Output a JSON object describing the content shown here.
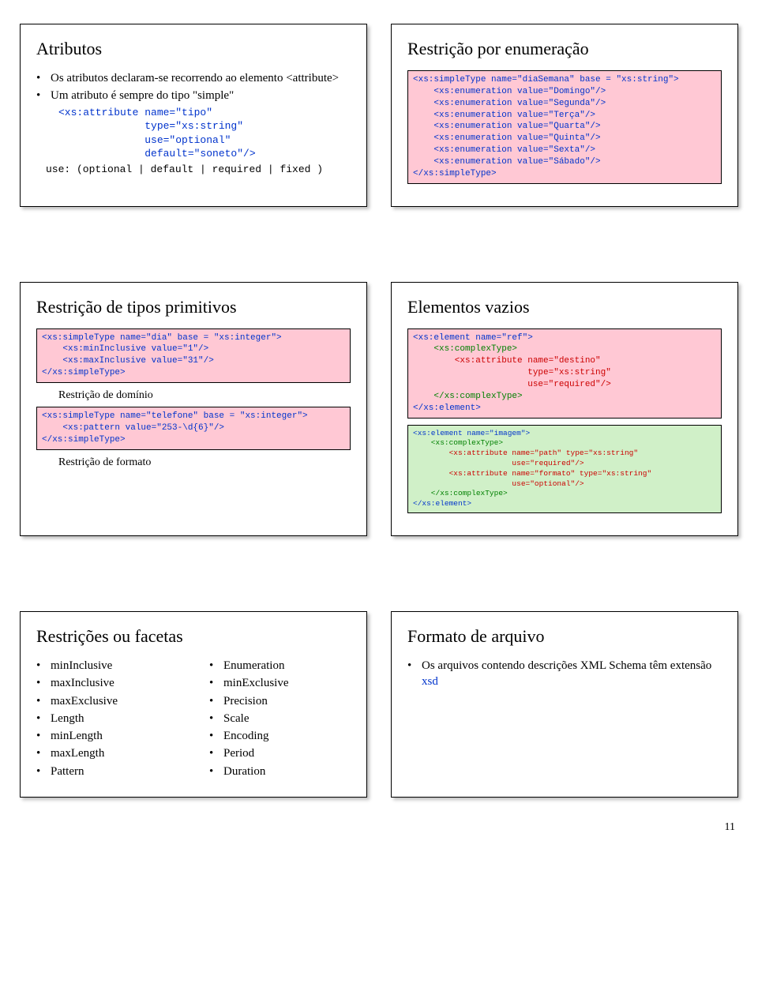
{
  "slide1": {
    "title": "Atributos",
    "b1": "Os atributos declaram-se recorrendo ao elemento <attribute>",
    "b2": "Um atributo é sempre do tipo \"simple\"",
    "code1": "<xs:attribute name=\"tipo\"",
    "code2": "              type=\"xs:string\"",
    "code3": "              use=\"optional\"",
    "code4": "              default=\"soneto\"/>",
    "note": "use: (optional | default | required | fixed )"
  },
  "slide2": {
    "title": "Restrição por enumeração",
    "l1": "<xs:simpleType name=\"diaSemana\" base = \"xs:string\">",
    "l2": "    <xs:enumeration value=\"Domingo\"/>",
    "l3": "    <xs:enumeration value=\"Segunda\"/>",
    "l4": "    <xs:enumeration value=\"Terça\"/>",
    "l5": "    <xs:enumeration value=\"Quarta\"/>",
    "l6": "    <xs:enumeration value=\"Quinta\"/>",
    "l7": "    <xs:enumeration value=\"Sexta\"/>",
    "l8": "    <xs:enumeration value=\"Sábado\"/>",
    "l9": "</xs:simpleType>"
  },
  "slide3": {
    "title": "Restrição de tipos primitivos",
    "box1l1": "<xs:simpleType name=\"dia\" base = \"xs:integer\">",
    "box1l2": "    <xs:minInclusive value=\"1\"/>",
    "box1l3": "    <xs:maxInclusive value=\"31\"/>",
    "box1l4": "</xs:simpleType>",
    "note1": "Restrição de domínio",
    "box2l1": "<xs:simpleType name=\"telefone\" base = \"xs:integer\">",
    "box2l2": "    <xs:pattern value=\"253-\\d{6}\"/>",
    "box2l3": "</xs:simpleType>",
    "note2": "Restrição de formato"
  },
  "slide4": {
    "title": "Elementos vazios",
    "b1l1": "<xs:element name=\"ref\">",
    "b1l2": "    <xs:complexType>",
    "b1l3": "        <xs:attribute name=\"destino\"",
    "b1l4": "                      type=\"xs:string\"",
    "b1l5": "                      use=\"required\"/>",
    "b1l6": "    </xs:complexType>",
    "b1l7": "</xs:element>",
    "b2l1": "<xs:element name=\"imagem\">",
    "b2l2": "    <xs:complexType>",
    "b2l3": "        <xs:attribute name=\"path\" type=\"xs:string\"",
    "b2l4": "                      use=\"required\"/>",
    "b2l5": "        <xs:attribute name=\"formato\" type=\"xs:string\"",
    "b2l6": "                      use=\"optional\"/>",
    "b2l7": "    </xs:complexType>",
    "b2l8": "</xs:element>"
  },
  "slide5": {
    "title": "Restrições ou facetas",
    "colA": [
      "minInclusive",
      "maxInclusive",
      "maxExclusive",
      "Length",
      "minLength",
      "maxLength",
      "Pattern"
    ],
    "colB": [
      "Enumeration",
      "minExclusive",
      "Precision",
      "Scale",
      "Encoding",
      "Period",
      "Duration"
    ]
  },
  "slide6": {
    "title": "Formato de arquivo",
    "b1a": "Os arquivos contendo descrições XML Schema têm extensão ",
    "b1b": "xsd"
  },
  "pageNum": "11"
}
